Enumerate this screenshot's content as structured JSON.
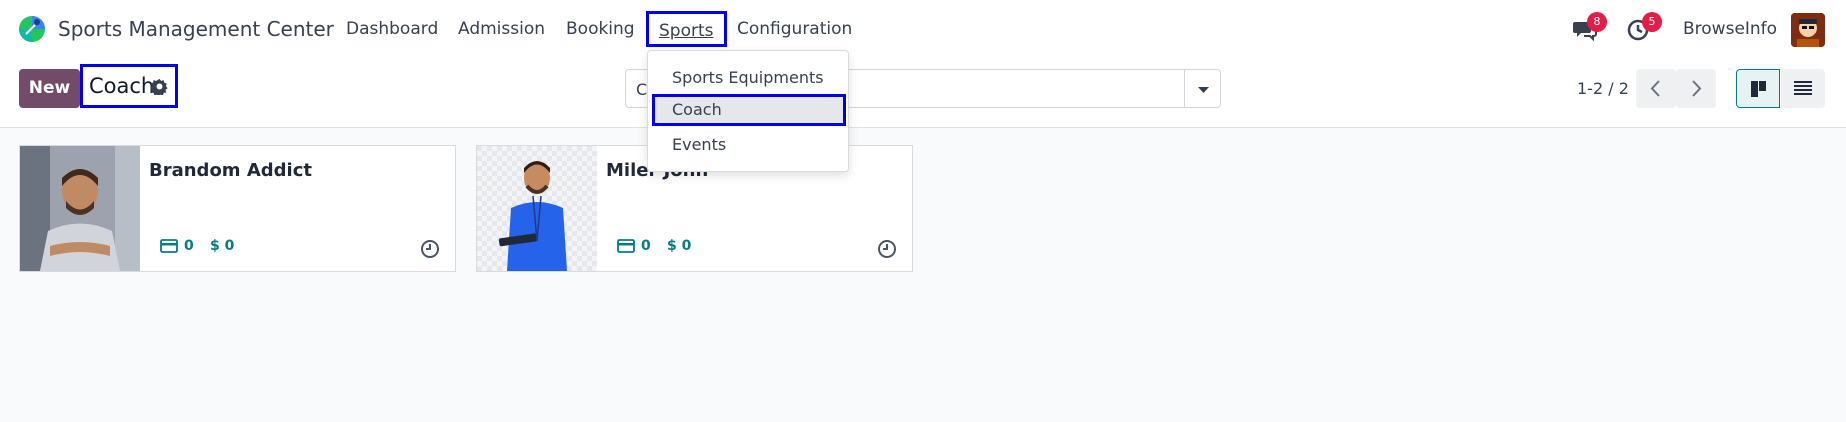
{
  "navbar": {
    "app_title": "Sports Management Center",
    "menu": [
      "Dashboard",
      "Admission",
      "Booking",
      "Sports",
      "Configuration"
    ],
    "active_menu": "Sports",
    "messages_badge": "8",
    "activities_badge": "5",
    "user_name": "BrowseInfo"
  },
  "control_panel": {
    "new_button": "New",
    "breadcrumb": "Coach",
    "search_value": "C",
    "pager": "1-2 / 2"
  },
  "dropdown": {
    "items": [
      "Sports Equipments",
      "Coach",
      "Events"
    ],
    "active_item": "Coach"
  },
  "cards": [
    {
      "name": "Brandom Addict",
      "count": "0",
      "amount": "$ 0",
      "photo_bg": "#9ca3af"
    },
    {
      "name": "Miler John",
      "count": "0",
      "amount": "$ 0",
      "photo_bg": "#e5e7eb"
    }
  ],
  "colors": {
    "primary": "#714b67",
    "accent": "#017e84",
    "highlight": "#0000ee",
    "badge": "#e11d48"
  },
  "icons": [
    "app-logo-icon",
    "settings-gear-icon",
    "chat-icon",
    "activity-clock-icon",
    "caret-down-icon",
    "chevron-left-icon",
    "chevron-right-icon",
    "kanban-view-icon",
    "list-view-icon",
    "credit-card-icon",
    "dollar-icon",
    "clock-icon"
  ]
}
